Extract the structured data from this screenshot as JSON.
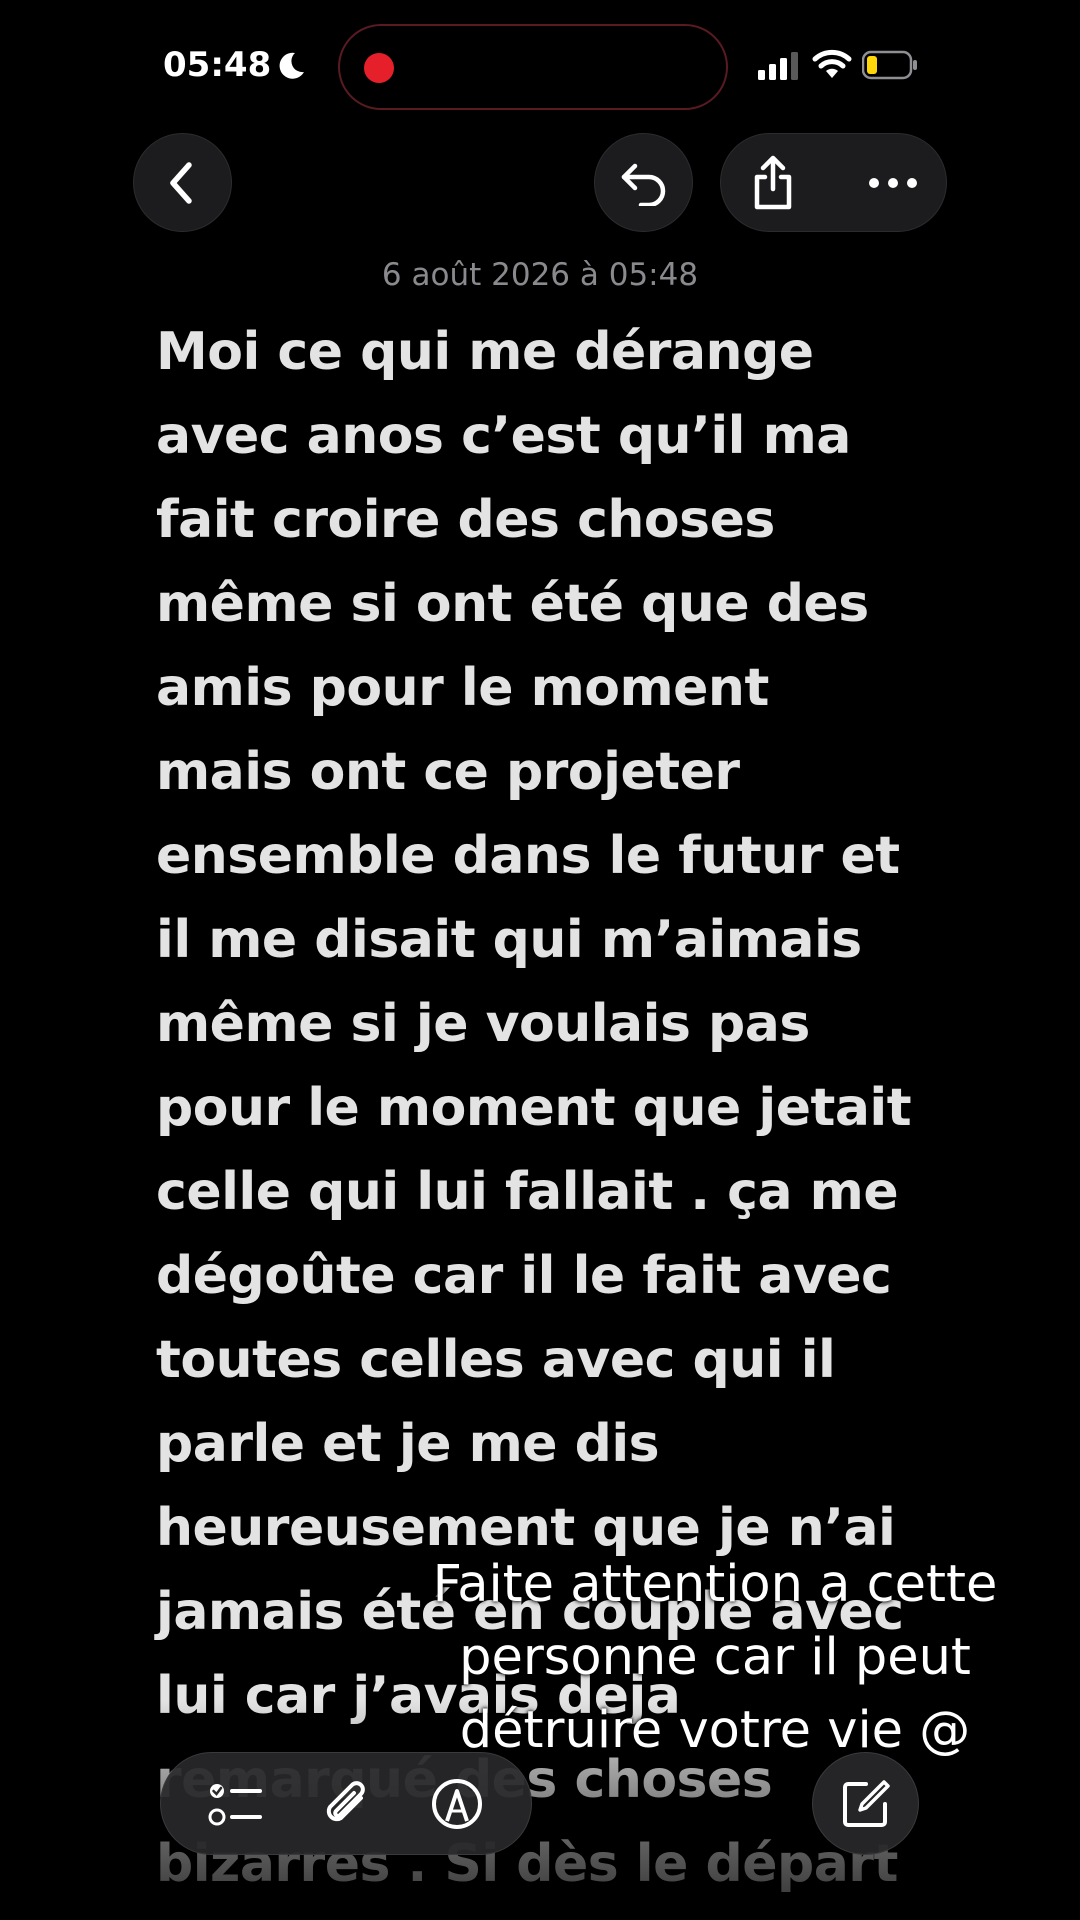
{
  "status_bar": {
    "time": "05:48"
  },
  "note": {
    "date": "6 août 2026 à 05:48",
    "body": "Moi ce qui me dérange\navec anos c’est qu’il ma\nfait croire des choses\nmême si ont été que des\namis pour le moment\nmais ont ce projeter\nensemble dans le futur et\nil me disait qui m’aimais\nmême si je voulais pas\npour le moment que jetait\ncelle qui lui fallait . ça me\ndégoûte car il le fait avec\ntoutes celles avec qui il\nparle et je me dis\nheureusement que je n’ai\njamais été en couple avec\nlui car j’avais deja\nremarqué des choses\nbizarres . Si dès le départ"
  },
  "overlay": {
    "caption": "Faite attention a cette\npersonne car il peut\ndétruire votre vie @"
  },
  "icons": {
    "back": "chevron-left-icon",
    "undo": "undo-arrow-icon",
    "share": "share-icon",
    "more": "ellipsis-icon",
    "checklist": "checklist-icon",
    "attach": "paperclip-icon",
    "markup": "pen-tip-icon",
    "compose": "compose-icon"
  },
  "colors": {
    "background": "#000000",
    "text": "#e3e3e3",
    "date": "#8a8a8e",
    "recording": "#e5202a",
    "battery": "#ffd60a"
  }
}
